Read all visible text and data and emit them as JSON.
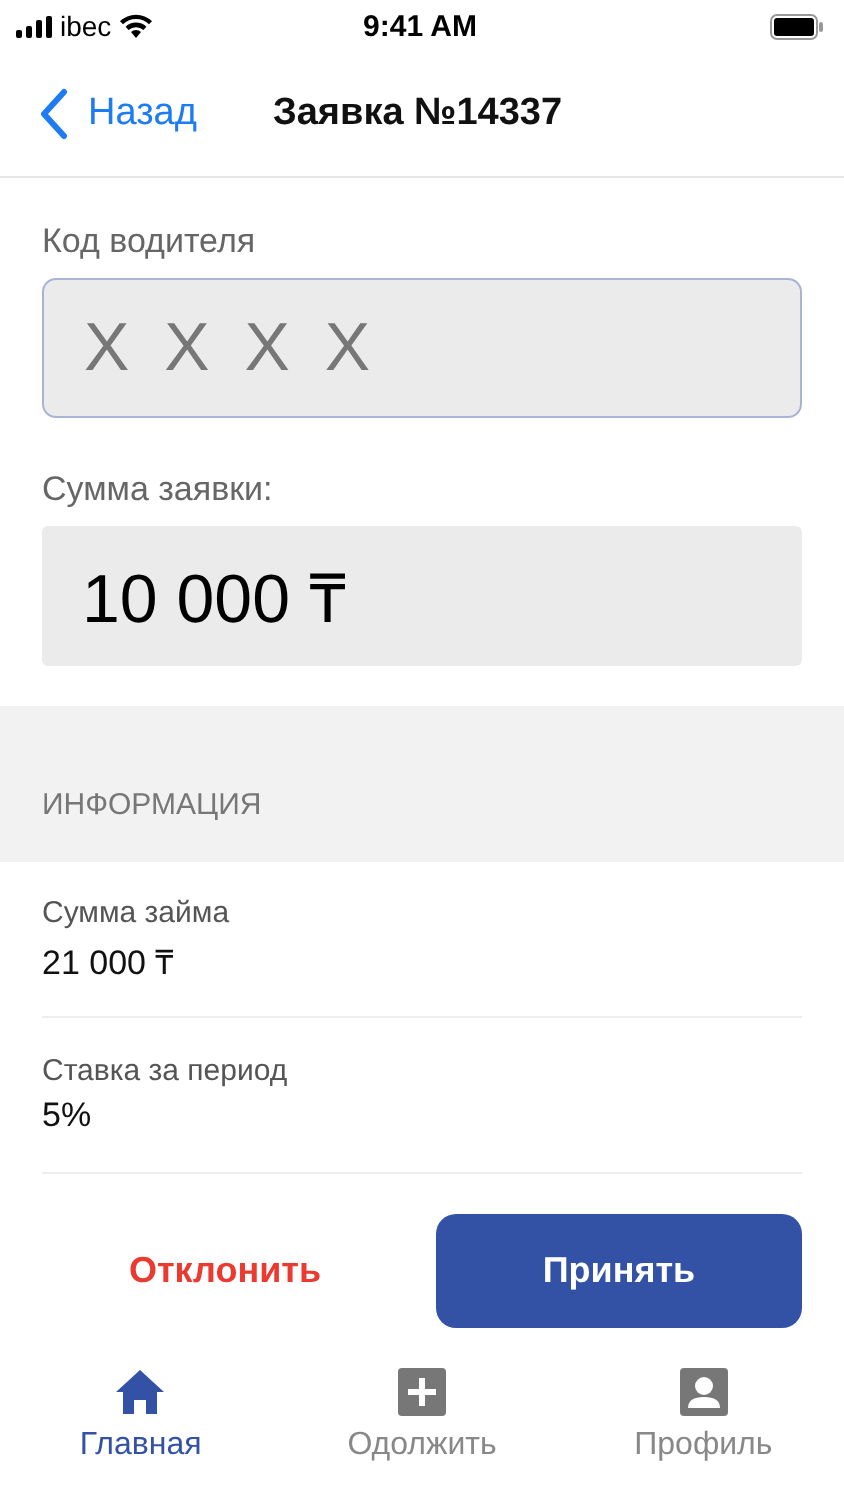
{
  "status_bar": {
    "carrier": "ibec",
    "time": "9:41 AM"
  },
  "nav": {
    "back": "Назад",
    "title": "Заявка №14337"
  },
  "code_field": {
    "label": "Код водителя",
    "placeholder": "X X X X"
  },
  "amount_field": {
    "label": "Сумма заявки:",
    "value": "10 000 ₸"
  },
  "info": {
    "header": "ИНФОРМАЦИЯ",
    "rows": [
      {
        "label": "Сумма займа",
        "value": "21 000 ₸"
      },
      {
        "label": "Ставка за период",
        "value": "5%"
      }
    ]
  },
  "buttons": [
    {
      "kind": "text",
      "label": "Отклонить"
    },
    {
      "kind": "primary",
      "label": "Принять"
    }
  ],
  "tabs": [
    {
      "kind": "home",
      "label": "Главная",
      "selected": true
    },
    {
      "kind": "lend",
      "label": "Одолжить",
      "selected": false
    },
    {
      "kind": "profile",
      "label": "Профиль",
      "selected": false
    }
  ]
}
